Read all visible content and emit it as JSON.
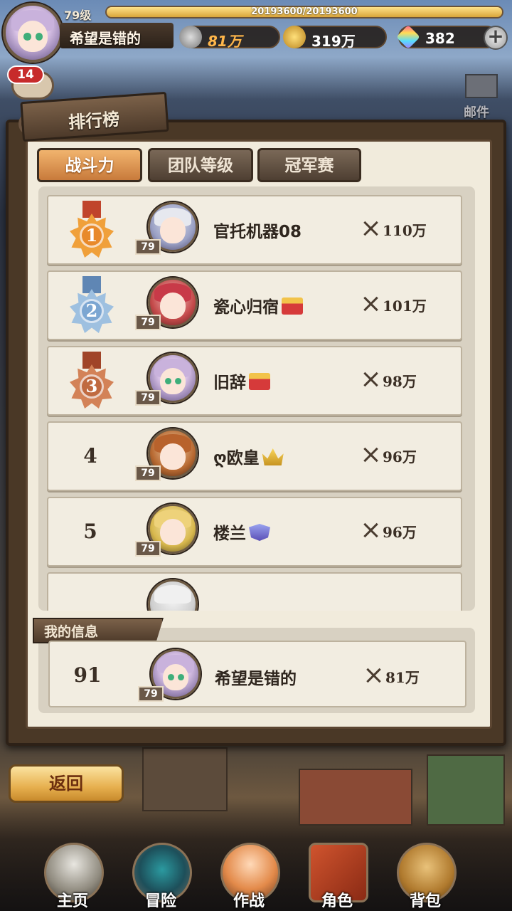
{
  "player": {
    "level": "79级",
    "exp": "20193600/20193600",
    "exp_fraction": 1.0,
    "name": "希望是错的",
    "power": "81万",
    "gold": "319万",
    "gems": "382",
    "chat_badge": "14"
  },
  "header": {
    "mail_label": "邮件",
    "panel_title": "排行榜"
  },
  "tabs": [
    {
      "label": "战斗力",
      "active": true
    },
    {
      "label": "团队等级",
      "active": false
    },
    {
      "label": "冠军赛",
      "active": false
    }
  ],
  "ranking": [
    {
      "rank": "1",
      "name": "官托机器08",
      "level": "79",
      "power": "110万",
      "badge": ""
    },
    {
      "rank": "2",
      "name": "瓷心归宿",
      "level": "79",
      "power": "101万",
      "badge": "red-crown"
    },
    {
      "rank": "3",
      "name": "旧辞",
      "level": "79",
      "power": "98万",
      "badge": "red-crown"
    },
    {
      "rank": "4",
      "name": "ღ欧皇",
      "level": "79",
      "power": "96万",
      "badge": "gold-crown"
    },
    {
      "rank": "5",
      "name": "楼兰",
      "level": "79",
      "power": "96万",
      "badge": "purple-crest"
    }
  ],
  "my_info": {
    "label": "我的信息",
    "rank": "91",
    "name": "希望是错的",
    "level": "79",
    "power": "81万"
  },
  "back_label": "返回",
  "nav": [
    {
      "label": "主页",
      "icon": "home-statue-icon"
    },
    {
      "label": "冒险",
      "icon": "adventure-gate-icon"
    },
    {
      "label": "作战",
      "icon": "battle-character-icon"
    },
    {
      "label": "角色",
      "icon": "character-book-icon"
    },
    {
      "label": "背包",
      "icon": "backpack-icon"
    }
  ],
  "colors": {
    "panel_bg": "#f1ebdc",
    "tab_active": "#e8964a",
    "frame_brown": "#4a3826"
  }
}
